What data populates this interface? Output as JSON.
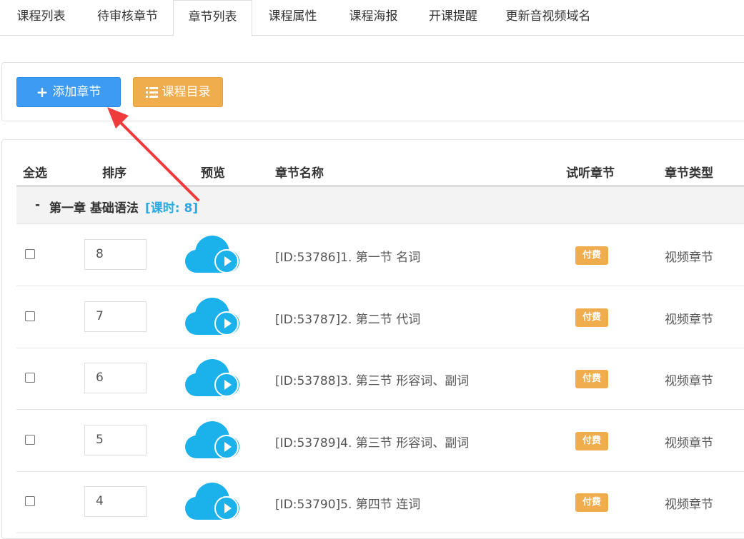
{
  "tabs": [
    {
      "label": "课程列表"
    },
    {
      "label": "待审核章节"
    },
    {
      "label": "章节列表",
      "active": true
    },
    {
      "label": "课程属性"
    },
    {
      "label": "课程海报"
    },
    {
      "label": "开课提醒"
    },
    {
      "label": "更新音视频域名"
    }
  ],
  "toolbar": {
    "add_label": "添加章节",
    "catalog_label": "课程目录"
  },
  "table": {
    "headers": {
      "select_all": "全选",
      "sort": "排序",
      "preview": "预览",
      "name": "章节名称",
      "trial": "试听章节",
      "type": "章节类型"
    },
    "chapter": {
      "toggle": "-",
      "title": "第一章 基础语法",
      "hours": "[课时: 8]"
    },
    "rows": [
      {
        "sort": "8",
        "name": "[ID:53786]1. 第一节 名词",
        "trial": "付费",
        "type": "视频章节"
      },
      {
        "sort": "7",
        "name": "[ID:53787]2. 第二节 代词",
        "trial": "付费",
        "type": "视频章节"
      },
      {
        "sort": "6",
        "name": "[ID:53788]3. 第三节 形容词、副词",
        "trial": "付费",
        "type": "视频章节"
      },
      {
        "sort": "5",
        "name": "[ID:53789]4. 第三节 形容词、副词",
        "trial": "付费",
        "type": "视频章节"
      },
      {
        "sort": "4",
        "name": "[ID:53790]5. 第四节 连词",
        "trial": "付费",
        "type": "视频章节"
      }
    ]
  },
  "colors": {
    "primary": "#3d9bf4",
    "warning": "#f0ad4e",
    "cloud": "#1bb1ea",
    "hours": "#29aae2",
    "arrow": "#ee3b3b"
  }
}
